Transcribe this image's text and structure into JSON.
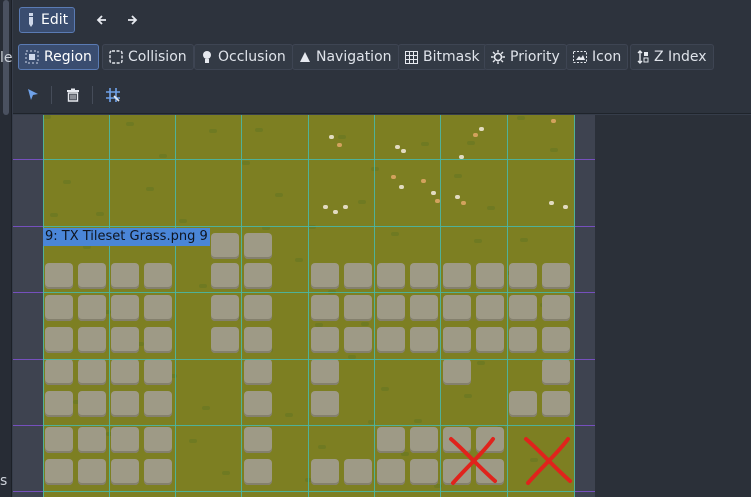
{
  "left_panel": {
    "text_top": "le",
    "text_bottom": "s"
  },
  "toolbar": {
    "edit_label": "Edit",
    "back_icon": "arrow-left-icon",
    "forward_icon": "arrow-right-icon"
  },
  "modes": [
    {
      "label": "Region",
      "icon": "region-icon",
      "active": true
    },
    {
      "label": "Collision",
      "icon": "collision-icon",
      "active": false
    },
    {
      "label": "Occlusion",
      "icon": "occlusion-icon",
      "active": false
    },
    {
      "label": "Navigation",
      "icon": "navigation-icon",
      "active": false
    },
    {
      "label": "Bitmask",
      "icon": "bitmask-icon",
      "active": false
    },
    {
      "label": "Priority",
      "icon": "priority-icon",
      "active": false
    },
    {
      "label": "Icon",
      "icon": "icon-mode-icon",
      "active": false
    },
    {
      "label": "Z Index",
      "icon": "z-index-icon",
      "active": false
    }
  ],
  "tools": [
    {
      "icon": "select-pointer-icon"
    },
    {
      "icon": "delete-trash-icon"
    },
    {
      "icon": "grid-snap-icon"
    }
  ],
  "viewport": {
    "region_label": "9: TX Tileset Grass.png 9",
    "texture_color": "#7d7f22",
    "grid_color": "#4bb7a4",
    "region_grid_color": "#7c52c9",
    "label_bg_color": "#4a86d8",
    "mark_color": "#e0231c"
  }
}
